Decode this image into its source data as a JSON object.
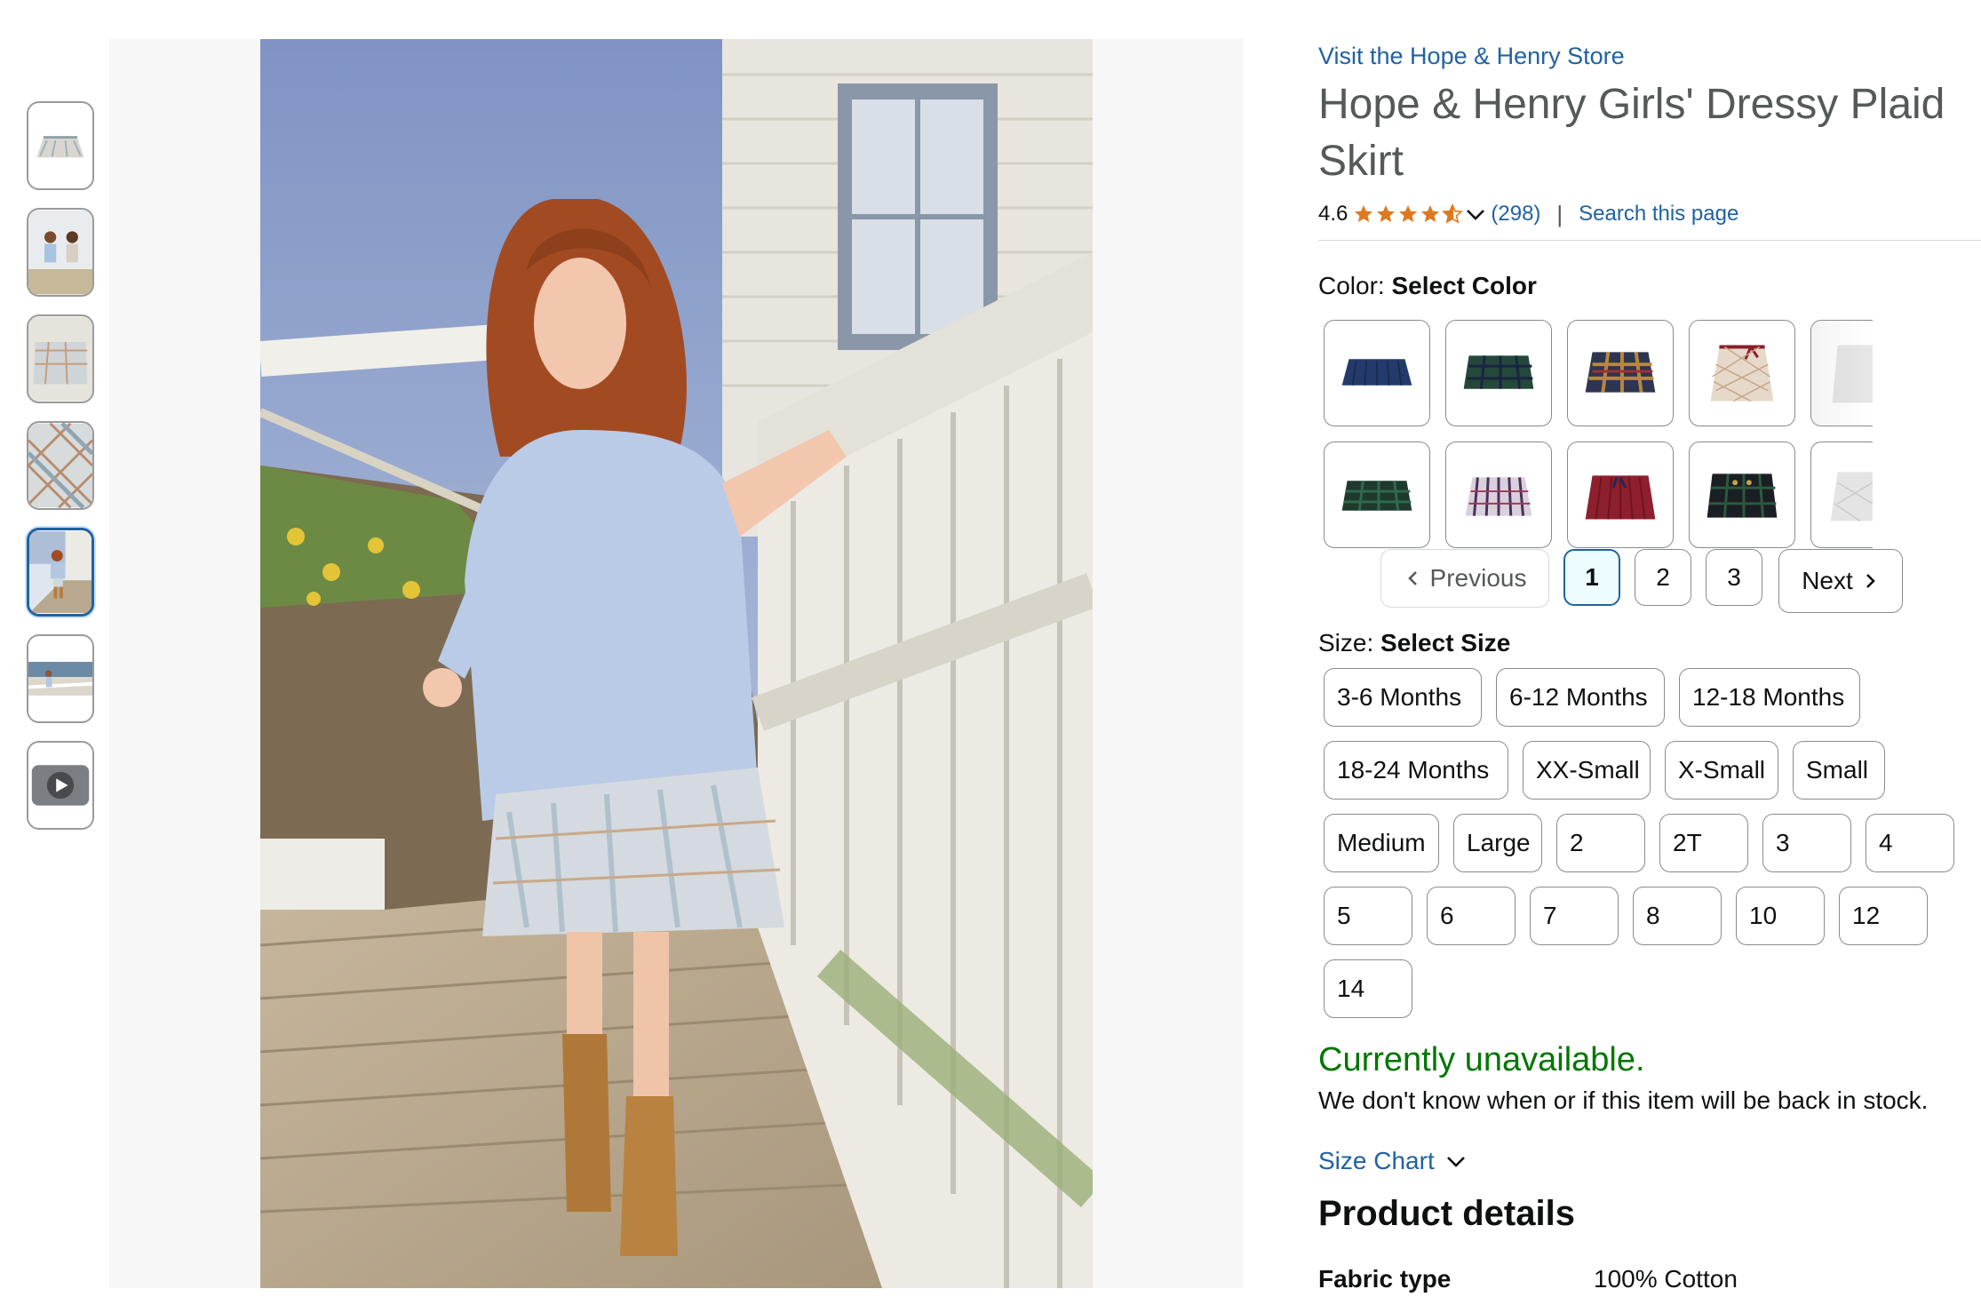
{
  "store_link": "Visit the Hope & Henry Store",
  "title": "Hope & Henry Girls' Dressy Plaid Skirt",
  "rating": {
    "value": "4.6",
    "stars": 4.6,
    "count": "(298)",
    "search": "Search this page"
  },
  "color": {
    "label": "Color:",
    "value": "Select Color"
  },
  "pagination": {
    "prev": "Previous",
    "pages": [
      "1",
      "2",
      "3"
    ],
    "current": "1",
    "next": "Next"
  },
  "size": {
    "label": "Size:",
    "value": "Select Size",
    "options": [
      "3-6 Months",
      "6-12 Months",
      "12-18 Months",
      "18-24 Months",
      "XX-Small",
      "X-Small",
      "Small",
      "Medium",
      "Large",
      "2",
      "2T",
      "3",
      "4",
      "5",
      "6",
      "7",
      "8",
      "10",
      "12",
      "14"
    ]
  },
  "availability": {
    "status": "Currently unavailable.",
    "message": "We don't know when or if this item will be back in stock."
  },
  "size_chart": "Size Chart",
  "product_details": {
    "title": "Product details",
    "rows": [
      {
        "key": "Fabric type",
        "value": "100% Cotton"
      }
    ]
  },
  "colors": {
    "link": "#2162a1",
    "available_green": "#007600",
    "star": "#de7921",
    "selected_thumb": "#2162a1"
  },
  "thumbnails": [
    "plaid-skirt-flat",
    "two-girls-photo",
    "skirt-detail",
    "plaid-fabric",
    "girl-walking-photo",
    "girl-on-boardwalk",
    "video-thumbnail"
  ],
  "swatches": [
    "navy-pleated",
    "green-plaid",
    "multicolor-plaid",
    "beige-plaid-bow",
    "white-partial",
    "dark-green-plaid",
    "purple-plaid",
    "burgundy-pleated",
    "black-green-plaid",
    "white-quilted-partial"
  ]
}
